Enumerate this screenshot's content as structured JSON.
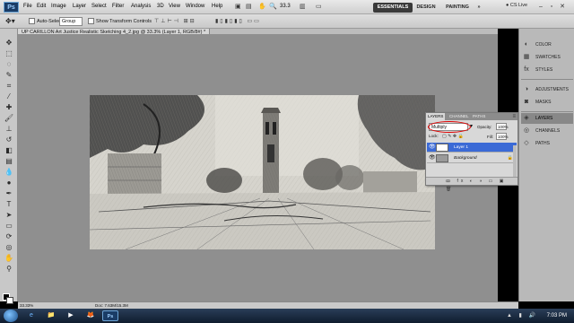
{
  "app": {
    "logo": "Ps",
    "menu": [
      "File",
      "Edit",
      "Image",
      "Layer",
      "Select",
      "Filter",
      "Analysis",
      "3D",
      "View",
      "Window",
      "Help"
    ],
    "zoom_field": "33.3",
    "workspaces": [
      "ESSENTIALS",
      "DESIGN",
      "PAINTING"
    ],
    "more": "»",
    "cs_live": "CS Live"
  },
  "options": {
    "auto_select_label": "Auto-Select:",
    "auto_select_value": "Group",
    "show_transform_label": "Show Transform Controls"
  },
  "document": {
    "tab_title": "UP CARILLON Art Justice Realistic Sketching 4_2.jpg @ 33.3% (Layer 1, RGB/8#) *",
    "zoom": "33.33%",
    "doc_size": "Doc: 7.63M/15.3M"
  },
  "layers_panel": {
    "tabs": [
      "LAYERS",
      "CHANNEL",
      "PATHS"
    ],
    "blend_mode": "Multiply",
    "opacity_label": "Opacity:",
    "opacity_value": "100%",
    "lock_label": "Lock:",
    "fill_label": "Fill:",
    "fill_value": "100%",
    "layers": [
      {
        "name": "Layer 1",
        "selected": true
      },
      {
        "name": "Background",
        "selected": false
      }
    ],
    "footer_icons": "ꝏ fx ◐ ◑ ▭ ▣ 🗑",
    "highlight_color": "#e00000"
  },
  "right_panel": {
    "group1": [
      {
        "icon": "color-icon",
        "glyph": "◐",
        "label": "COLOR"
      },
      {
        "icon": "swatches-icon",
        "glyph": "▦",
        "label": "SWATCHES"
      },
      {
        "icon": "styles-icon",
        "glyph": "fx",
        "label": "STYLES"
      }
    ],
    "group2": [
      {
        "icon": "adjustments-icon",
        "glyph": "◑",
        "label": "ADJUSTMENTS"
      },
      {
        "icon": "masks-icon",
        "glyph": "◙",
        "label": "MASKS"
      }
    ],
    "group3": [
      {
        "icon": "layers-icon",
        "glyph": "◈",
        "label": "LAYERS"
      },
      {
        "icon": "channels-icon",
        "glyph": "◎",
        "label": "CHANNELS"
      },
      {
        "icon": "paths-icon",
        "glyph": "◇",
        "label": "PATHS"
      }
    ]
  },
  "taskbar": {
    "apps": [
      "e",
      "📁",
      "▶",
      "🦊",
      "Ps"
    ],
    "time": "7:03 PM"
  }
}
